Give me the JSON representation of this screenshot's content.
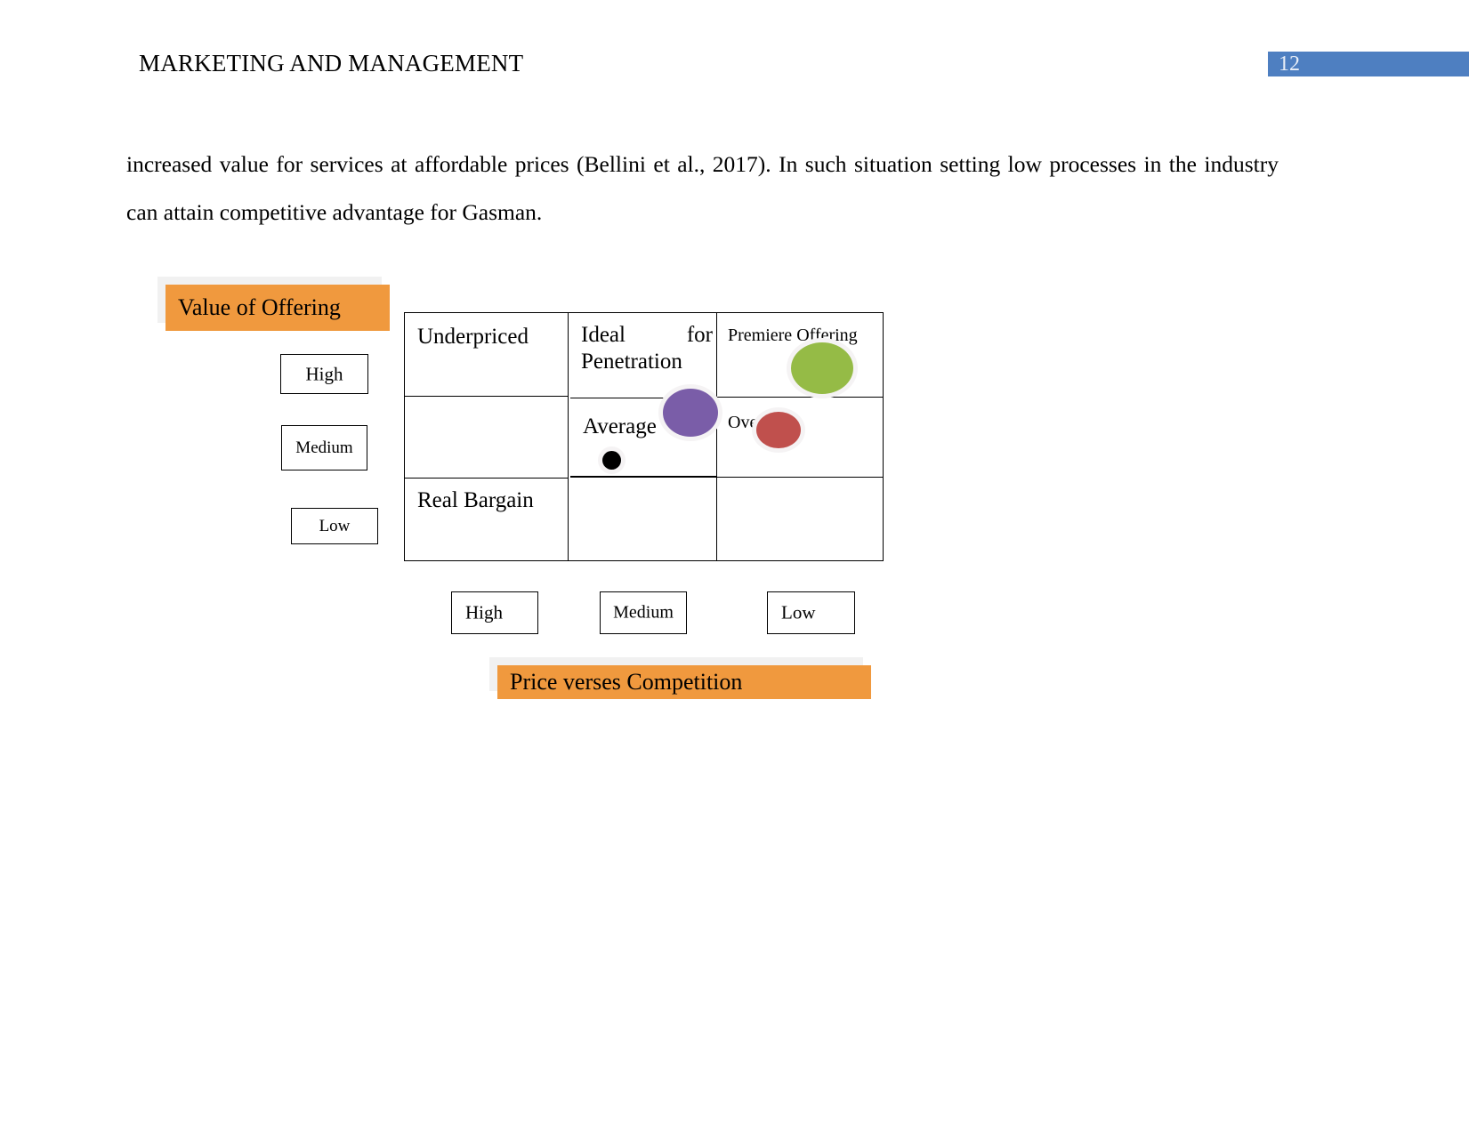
{
  "header": {
    "title": "MARKETING AND MANAGEMENT",
    "page_number": "12",
    "badge_color": "#4E7FC1"
  },
  "body": {
    "paragraph": "increased value for services at affordable prices (Bellini et al., 2017). In such situation setting low processes in the industry can attain competitive advantage for Gasman."
  },
  "figure": {
    "vertical_axis": {
      "title": "Value of Offering",
      "labels": [
        "High",
        "Medium",
        "Low"
      ]
    },
    "horizontal_axis": {
      "title": "Price verses Competition",
      "labels": [
        "High",
        "Medium",
        "Low"
      ]
    },
    "matrix": {
      "cells": [
        {
          "label": "Underpriced"
        },
        {
          "label": "Ideal for Penetration"
        },
        {
          "label": "Premiere Offering"
        },
        {
          "label": "Real Bargain"
        },
        {
          "label": "Average"
        },
        {
          "label": "Over"
        },
        {
          "label": ""
        },
        {
          "label": ""
        },
        {
          "label": ""
        }
      ]
    },
    "bubbles": [
      {
        "name": "premiere-offering",
        "color": "#95BB46"
      },
      {
        "name": "ideal-for-penetration",
        "color": "#7A5DA8"
      },
      {
        "name": "overpriced",
        "color": "#C0504D"
      },
      {
        "name": "average",
        "color": "#000000"
      }
    ],
    "banner_color": "#F0993E"
  }
}
